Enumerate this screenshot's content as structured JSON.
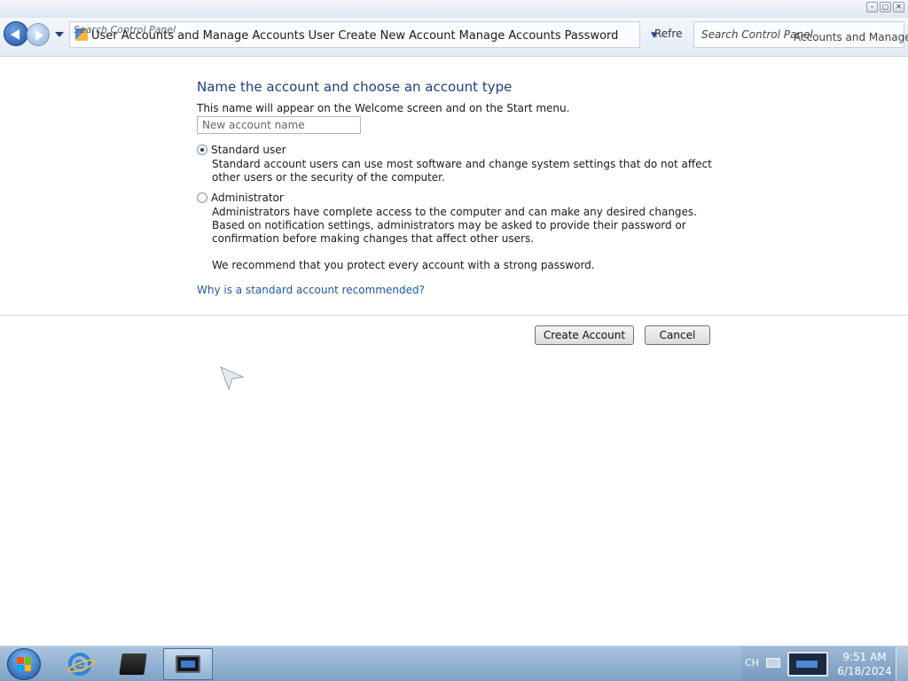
{
  "window": {
    "controls": {
      "minimize": "–",
      "maximize": "▢",
      "close": "✕"
    }
  },
  "navbar": {
    "address_ghost": "Search Control Panel",
    "breadcrumb": [
      "User Accounts and",
      "Manage Accounts",
      "User",
      "Create New Account",
      "Manage Accounts",
      "Password"
    ],
    "refresh_label": "Refre",
    "search_placeholder": "Search Control Panel",
    "search_ghost": "Accounts and Manage"
  },
  "main": {
    "heading": "Name the account and choose an account type",
    "subtext": "This name will appear on the Welcome screen and on the Start menu.",
    "name_placeholder": "New account name",
    "standard": {
      "label": "Standard user",
      "description": "Standard account users can use most software and change system settings that do not affect other users or the security of the computer."
    },
    "admin": {
      "label": "Administrator",
      "description": "Administrators have complete access to the computer and can make any desired changes. Based on notification settings, administrators may be asked to provide their password or confirmation before making changes that affect other users.",
      "recommendation": "We recommend that you protect every account with a strong password."
    },
    "help_link": "Why is a standard account recommended?",
    "create_button": "Create Account",
    "cancel_button": "Cancel"
  },
  "taskbar": {
    "tray": {
      "language": "CH",
      "time": "9:51 AM",
      "date": "6/18/2024"
    }
  },
  "colors": {
    "heading": "#1e3f7a",
    "link": "#1f5aa6",
    "taskbar": "#7fa2c7"
  }
}
